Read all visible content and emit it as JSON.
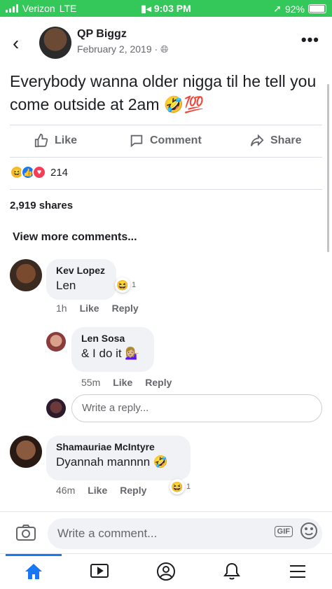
{
  "status_bar": {
    "carrier": "Verizon",
    "network": "LTE",
    "time": "9:03 PM",
    "battery": "92%"
  },
  "post": {
    "author": "QP Biggz",
    "date": "February 2, 2019 · ",
    "text": "Everybody wanna older nigga til he tell you come outside at 2am 🤣💯",
    "actions": {
      "like": "Like",
      "comment": "Comment",
      "share": "Share"
    },
    "reaction_count": "214",
    "shares": "2,919 shares",
    "view_more": "View more comments..."
  },
  "comments": [
    {
      "name": "Kev Lopez",
      "text": "Len",
      "time": "1h",
      "like": "Like",
      "reply": "Reply",
      "reaction": "😆",
      "reaction_count": "1"
    },
    {
      "name": "Len Sosa",
      "text": "& I do it 💁🏼‍♀️",
      "time": "55m",
      "like": "Like",
      "reply": "Reply"
    },
    {
      "name": "Shamauriae McIntyre",
      "text": "Dyannah mannnn 🤣",
      "time": "46m",
      "like": "Like",
      "reply": "Reply",
      "reaction": "😆",
      "reaction_count": "1"
    }
  ],
  "reply_placeholder": "Write a reply...",
  "compose": {
    "placeholder": "Write a comment...",
    "gif": "GIF"
  },
  "colors": {
    "status_green": "#34c759",
    "accent_blue": "#1877f2",
    "bubble_bg": "#f0f2f5",
    "muted": "#65676b"
  }
}
